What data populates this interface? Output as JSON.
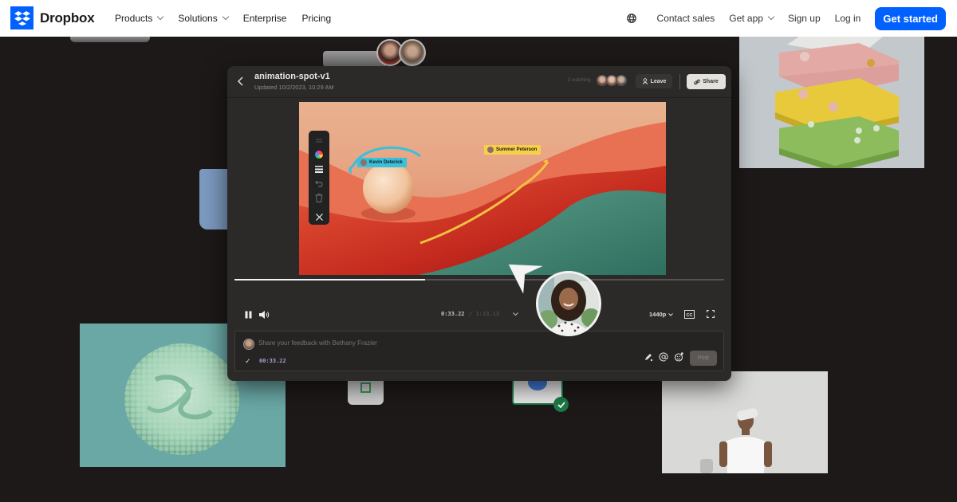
{
  "nav": {
    "brand": "Dropbox",
    "left_items": [
      {
        "label": "Products",
        "has_dropdown": true
      },
      {
        "label": "Solutions",
        "has_dropdown": true
      },
      {
        "label": "Enterprise",
        "has_dropdown": false
      },
      {
        "label": "Pricing",
        "has_dropdown": false
      }
    ],
    "right_items": [
      {
        "label": "Contact sales",
        "has_dropdown": false
      },
      {
        "label": "Get app",
        "has_dropdown": true
      },
      {
        "label": "Sign up",
        "has_dropdown": false
      },
      {
        "label": "Log in",
        "has_dropdown": false
      }
    ],
    "language_icon": "globe-icon",
    "cta_label": "Get started",
    "accent_color": "#0061fe"
  },
  "player": {
    "title": "animation-spot-v1",
    "updated": "Updated 10/2/2023, 10:29 AM",
    "watching": "3 watching",
    "leave_label": "Leave",
    "share_label": "Share",
    "annotations": [
      {
        "name": "Kevin Deterick",
        "color": "#38c0dc"
      },
      {
        "name": "Summer Peterson",
        "color": "#f7d04b"
      }
    ],
    "toolbar_tools": [
      "drag-handle-icon",
      "color-wheel-icon",
      "stroke-width-icon",
      "undo-icon",
      "trash-icon",
      "close-icon"
    ],
    "progress_fraction": 0.39,
    "current_time": "0:33.22",
    "separator": "/",
    "total_time": "1:13.13",
    "quality": "1440p",
    "comment": {
      "placeholder": "Share your feedback with Bethany Frazier",
      "timestamp": "00:33.22",
      "post_label": "Post"
    }
  },
  "colors": {
    "page_bg": "#1e1919",
    "player_bg": "#2b2a29",
    "success_green": "#1c7a46"
  }
}
